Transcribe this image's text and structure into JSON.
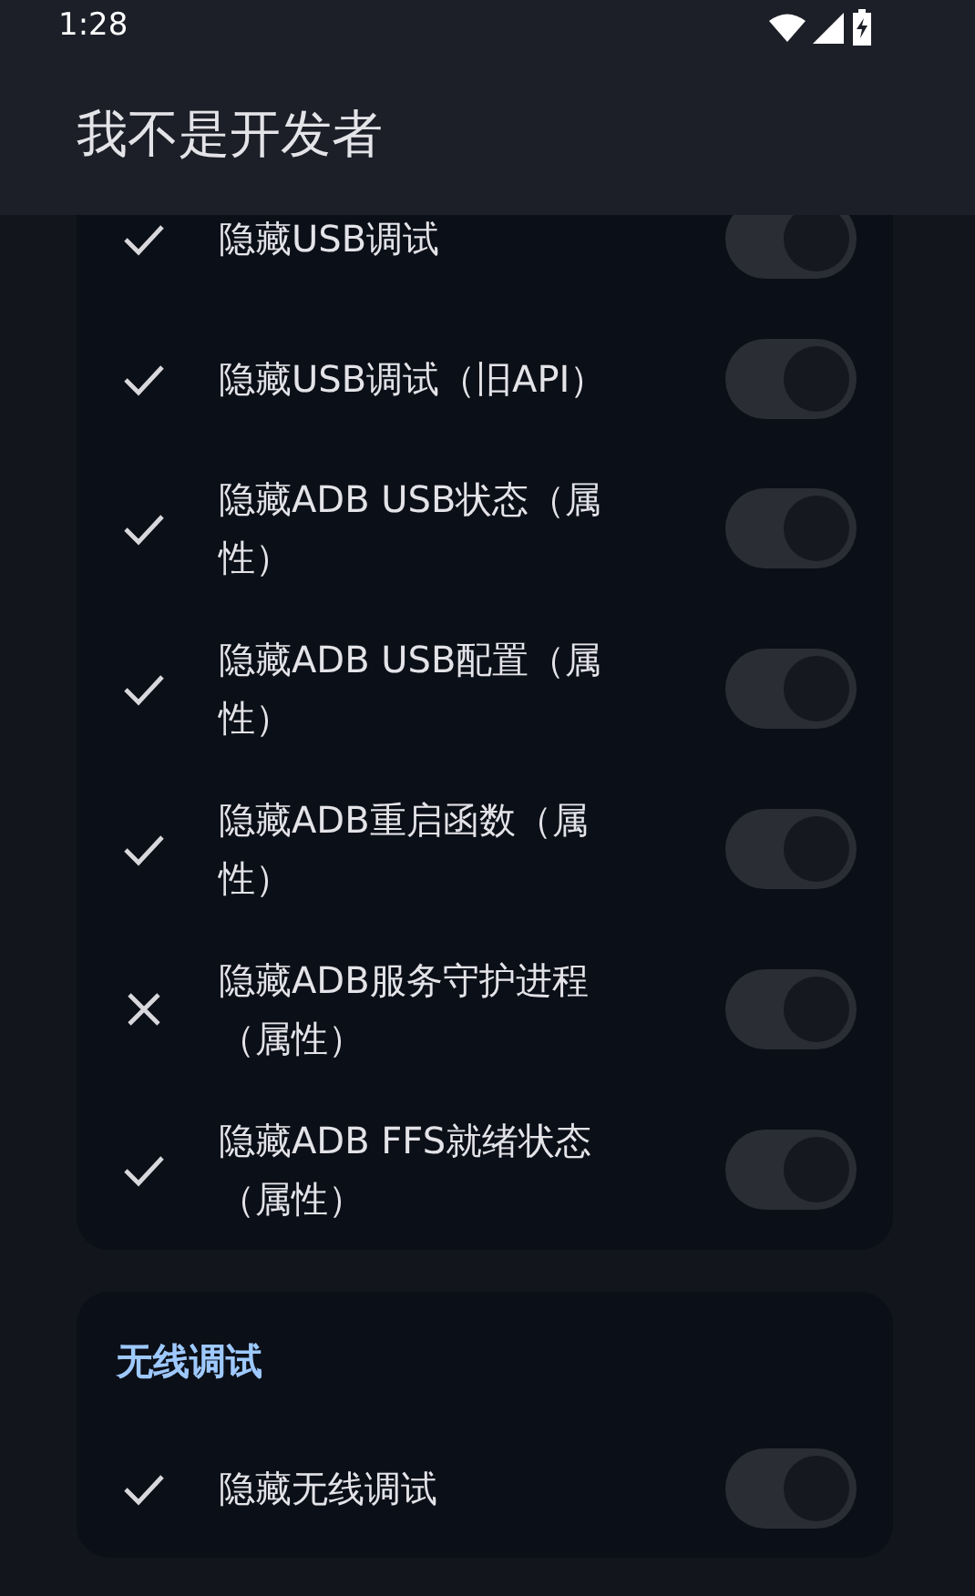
{
  "status_bar": {
    "time": "1:28"
  },
  "app_bar": {
    "title": "我不是开发者"
  },
  "sections": [
    {
      "rows": [
        {
          "label": "隐藏USB调试",
          "kind": "check",
          "on": true
        },
        {
          "label": "隐藏USB调试（旧API）",
          "kind": "check",
          "on": true
        },
        {
          "label": "隐藏ADB USB状态（属性）",
          "kind": "check",
          "on": true
        },
        {
          "label": "隐藏ADB USB配置（属性）",
          "kind": "check",
          "on": true
        },
        {
          "label": "隐藏ADB重启函数（属性）",
          "kind": "check",
          "on": true
        },
        {
          "label": "隐藏ADB服务守护进程（属性）",
          "kind": "cross",
          "on": true
        },
        {
          "label": "隐藏ADB FFS就绪状态（属性）",
          "kind": "check",
          "on": true
        }
      ]
    },
    {
      "header": "无线调试",
      "rows": [
        {
          "label": "隐藏无线调试",
          "kind": "check",
          "on": true
        }
      ]
    }
  ]
}
